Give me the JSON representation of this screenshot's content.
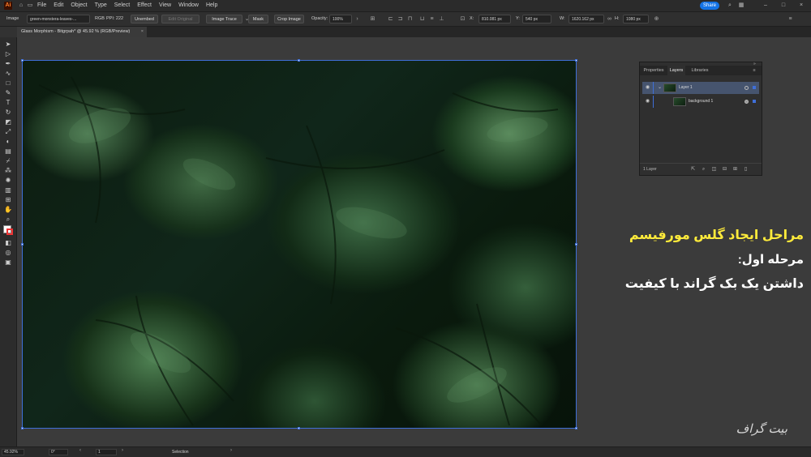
{
  "app": {
    "logo": "Ai",
    "menus": [
      "File",
      "Edit",
      "Object",
      "Type",
      "Select",
      "Effect",
      "View",
      "Window",
      "Help"
    ],
    "share_label": "Share"
  },
  "control_bar": {
    "object_type": "Image",
    "filename": "green-monstera-leaves-...",
    "color_mode": "RGB",
    "ppi": "PPI: 222",
    "embed_label": "Unembed",
    "edit_label": "Edit Original",
    "image_trace_label": "Image Trace",
    "mask_label": "Mask",
    "crop_label": "Crop Image",
    "opacity_label": "Opacity:",
    "opacity_value": "100%",
    "x_label": "X:",
    "x_value": "810.081 px",
    "y_label": "Y:",
    "y_value": "540 px",
    "w_label": "W:",
    "w_value": "1620.162 px",
    "h_label": "H:",
    "h_value": "1080 px"
  },
  "document": {
    "tab_title": "Glass Morphism - Bitgrpah* @ 45.92 % (RGB/Preview)",
    "close_glyph": "×"
  },
  "layers_panel": {
    "tabs": [
      "Properties",
      "Layers",
      "Libraries"
    ],
    "active_tab": "Layers",
    "layers": [
      {
        "name": "Layer 1",
        "selected": true
      },
      {
        "name": "background 1",
        "selected": false
      }
    ],
    "footer_count": "1 Layer"
  },
  "overlay_text": {
    "title": "مراحل ایجاد گلس مورفیسم",
    "step": "مرحله اول:",
    "description": "داشتن یک بک گراند با کیفیت",
    "title_color": "#ffeb3b",
    "text_color": "#ffffff"
  },
  "watermark": "بیت گراف",
  "status_bar": {
    "zoom": "45.92%",
    "rotation": "0°",
    "artboard_number": "1",
    "tool_name": "Selection"
  }
}
